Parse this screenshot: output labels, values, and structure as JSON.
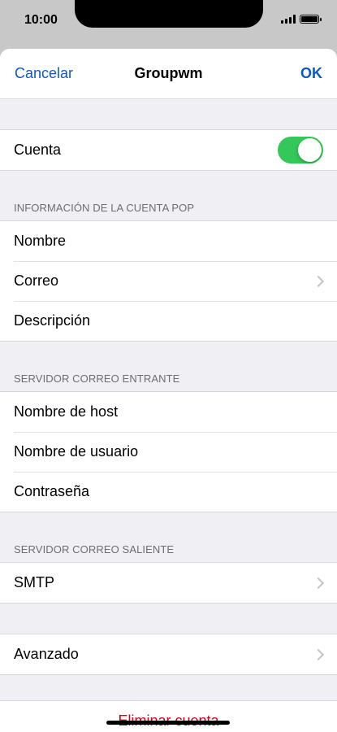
{
  "status_bar": {
    "time": "10:00",
    "icons": [
      "cellular-signal-icon",
      "battery-icon"
    ]
  },
  "navbar": {
    "cancel_label": "Cancelar",
    "title": "Groupwm",
    "ok_label": "OK"
  },
  "account": {
    "label": "Cuenta",
    "enabled": true
  },
  "sections": {
    "pop_info": {
      "header": "INFORMACIÓN DE LA CUENTA POP",
      "rows": [
        "Nombre",
        "Correo",
        "Descripción"
      ]
    },
    "incoming": {
      "header": "SERVIDOR CORREO ENTRANTE",
      "rows": [
        "Nombre de host",
        "Nombre de usuario",
        "Contraseña"
      ]
    },
    "outgoing": {
      "header": "SERVIDOR CORREO SALIENTE",
      "rows": [
        "SMTP"
      ]
    },
    "advanced": {
      "rows": [
        "Avanzado"
      ]
    }
  },
  "delete_label": "Eliminar cuenta",
  "colors": {
    "accent": "#0a59c7",
    "toggle_on": "#34c759",
    "destructive": "#d0021b",
    "grouped_background": "#efeff4"
  }
}
